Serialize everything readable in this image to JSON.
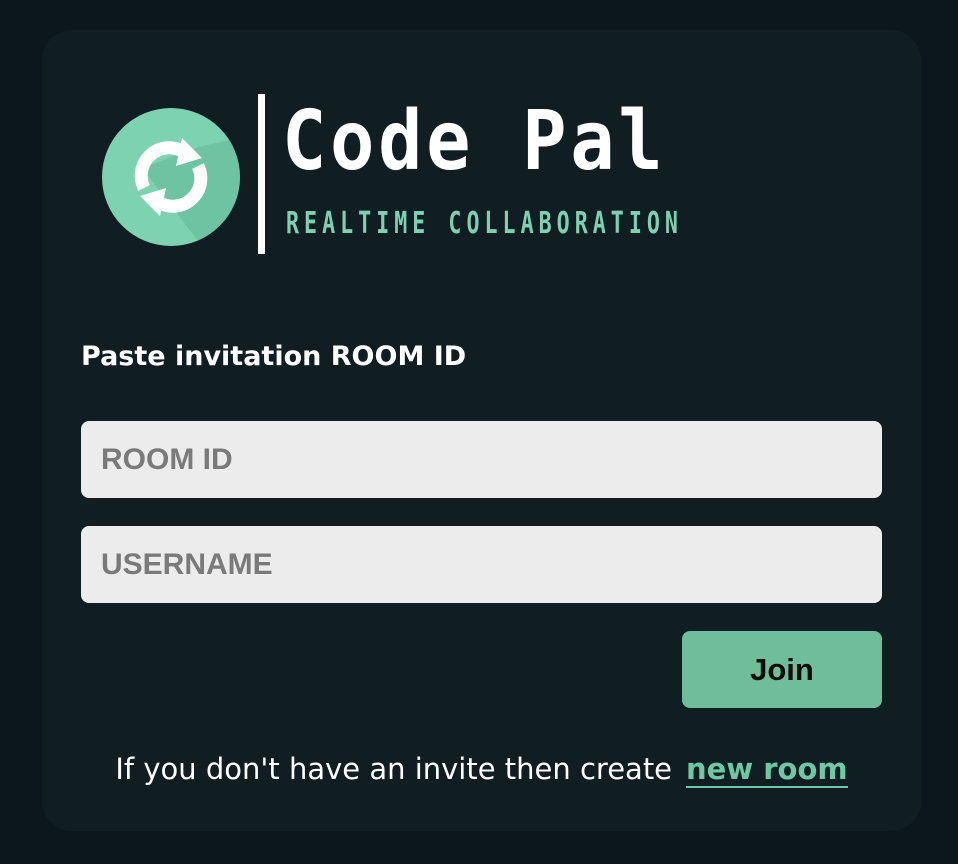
{
  "colors": {
    "page_background": "#0b171c",
    "card_background": "#101e22",
    "accent": "#6fbd99",
    "logo_circle": "#7dd3b1",
    "input_background": "#ececec"
  },
  "logo": {
    "icon": "refresh-icon",
    "title": "Code Pal",
    "subtitle": "RealTime Collaboration"
  },
  "form": {
    "label": "Paste invitation ROOM ID",
    "room_id": {
      "placeholder": "ROOM ID",
      "value": ""
    },
    "username": {
      "placeholder": "USERNAME",
      "value": ""
    },
    "join_label": "Join"
  },
  "footer": {
    "text": "If you don't have an invite then create",
    "link_label": "new room"
  }
}
